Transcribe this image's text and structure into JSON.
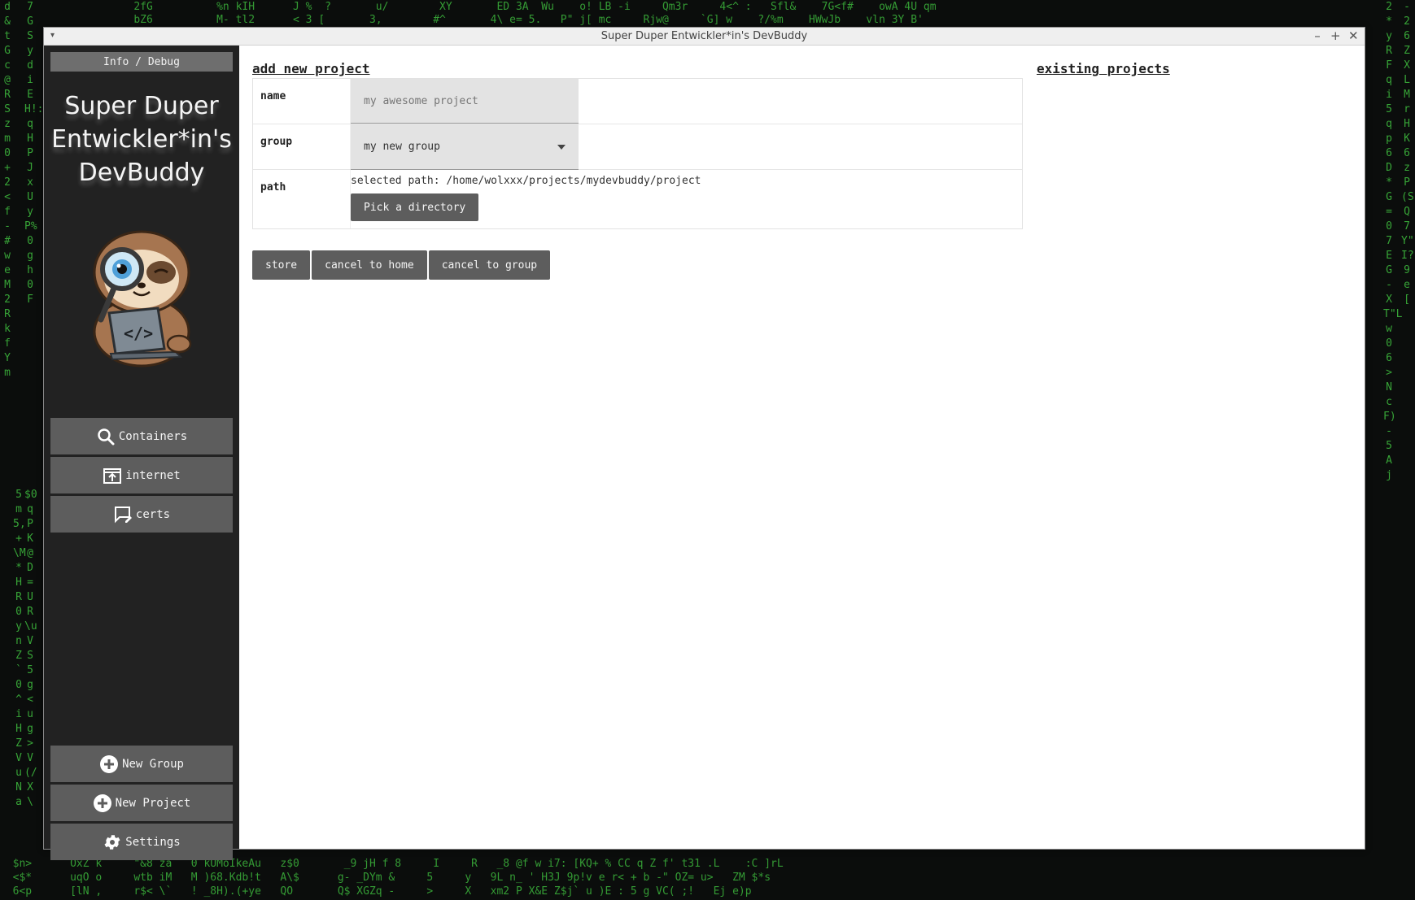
{
  "window": {
    "title": "Super Duper Entwickler*in's DevBuddy",
    "controls": {
      "minimize": "–",
      "maximize": "+",
      "close": "✕"
    },
    "menu_glyph": "▾"
  },
  "sidebar": {
    "info_button": "Info / Debug",
    "app_title_lines": [
      "Super Duper",
      "Entwickler*in's",
      "DevBuddy"
    ],
    "nav_top": [
      {
        "label": "Containers",
        "icon": "search-icon"
      },
      {
        "label": "internet",
        "icon": "upload-window-icon"
      },
      {
        "label": "certs",
        "icon": "chat-edit-icon"
      }
    ],
    "nav_bottom": [
      {
        "label": "New Group",
        "icon": "plus-circle-icon"
      },
      {
        "label": "New Project",
        "icon": "plus-circle-icon"
      },
      {
        "label": "Settings",
        "icon": "gear-icon"
      }
    ]
  },
  "main": {
    "add_title": "add new project",
    "existing_title": "existing projects",
    "form": {
      "name_label": "name",
      "name_placeholder": "my awesome project",
      "group_label": "group",
      "group_value": "my new group",
      "path_label": "path",
      "path_text": "selected path: /home/wolxxx/projects/mydevbuddy/project",
      "pick_button": "Pick a directory"
    },
    "actions": {
      "store": "store",
      "cancel_home": "cancel to home",
      "cancel_group": "cancel to group"
    }
  },
  "colors": {
    "sidebar_bg": "#222222",
    "button_bg": "#5d5d5d",
    "matrix_green": "#3fbf3f"
  }
}
